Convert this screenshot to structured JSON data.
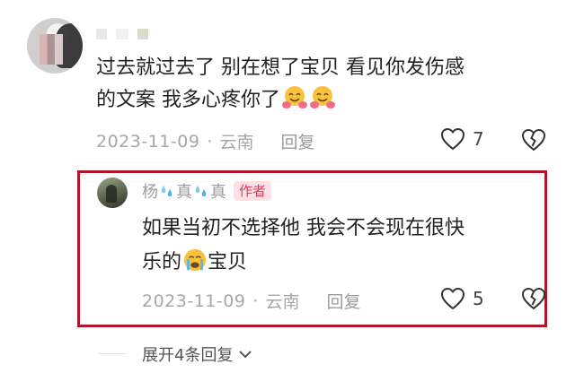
{
  "comment": {
    "text_part1": "过去就过去了 别在想了宝贝 看见你发伤感",
    "text_part2": "的文案 我多心疼你了",
    "emoji_name": "hugging-face-emoji",
    "date": "2023-11-09",
    "separator": "·",
    "location": "云南",
    "reply_label": "回复",
    "likes": "7"
  },
  "reply": {
    "name_char1": "杨",
    "name_char2": "真",
    "name_char3": "真",
    "author_badge": "作者",
    "text_part1": "如果当初不选择他 我会不会现在很快",
    "text_part2_a": "乐的",
    "text_part2_b": "宝贝",
    "emoji_name": "crying-face-emoji",
    "date": "2023-11-09",
    "separator": "·",
    "location": "云南",
    "reply_label": "回复",
    "likes": "5"
  },
  "expand": {
    "label": "展开4条回复"
  },
  "colors": {
    "highlight_border": "#b0162a",
    "badge_bg": "#fde1e6",
    "badge_text": "#e23a56",
    "meta_text": "#a7a7a7"
  }
}
